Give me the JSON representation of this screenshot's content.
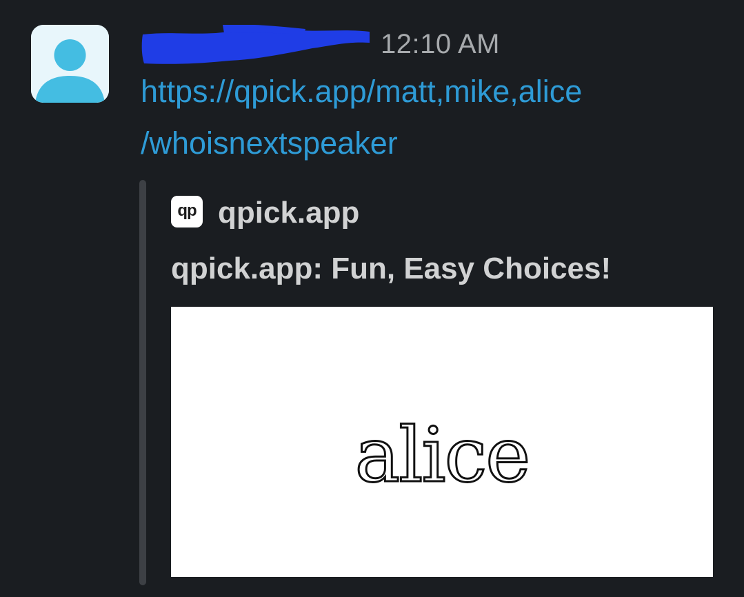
{
  "message": {
    "avatar_icon": "default-user-avatar-icon",
    "author_name_redacted": true,
    "redaction_color": "#1f3de6",
    "timestamp": "12:10 AM",
    "link_line1": "https://qpick.app/matt,mike,alice",
    "link_line2": "/whoisnextspeaker",
    "link_color": "#2e9bd6"
  },
  "unfurl": {
    "site_icon_text": "qp",
    "site_name": "qpick.app",
    "title": "qpick.app: Fun, Easy Choices!",
    "image_text": "alice"
  }
}
